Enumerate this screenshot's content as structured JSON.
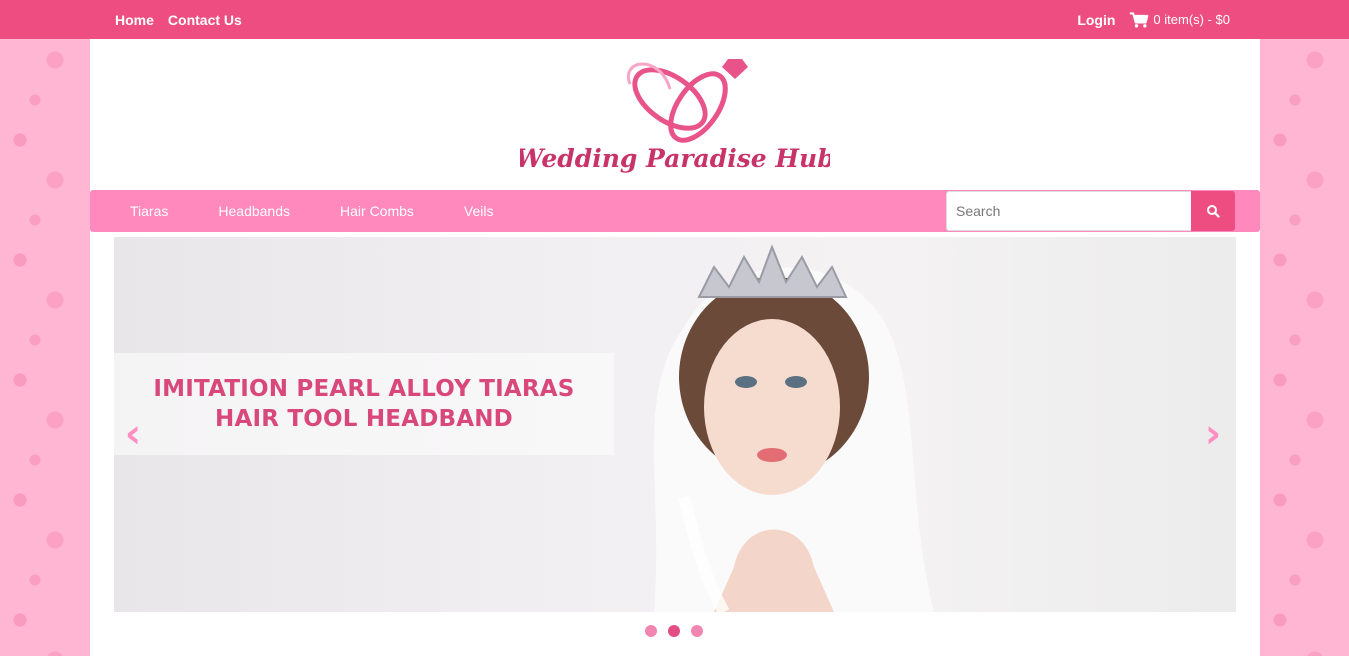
{
  "topbar": {
    "home": "Home",
    "contact": "Contact Us",
    "login": "Login",
    "cart_text": "0 item(s) - $0",
    "cart_icon": "shopping-cart-icon"
  },
  "brand": {
    "name": "Wedding Paradise Hub",
    "logo_icon": "wedding-rings-heart-icon"
  },
  "menu": {
    "items": [
      "Tiaras",
      "Headbands",
      "Hair Combs",
      "Veils"
    ]
  },
  "search": {
    "placeholder": "Search",
    "value": "",
    "icon": "search-icon"
  },
  "slider": {
    "caption_line1": "IMITATION PEARL ALLOY TIARAS",
    "caption_line2": "HAIR TOOL HEADBAND",
    "prev_arrow": "‹",
    "next_arrow": "›",
    "slide_count": 3,
    "active_slide": 2
  },
  "colors": {
    "topbar": "#ee4d82",
    "navbar": "#ff88bd",
    "accent": "#e24d83",
    "background": "#ffb6d3"
  }
}
